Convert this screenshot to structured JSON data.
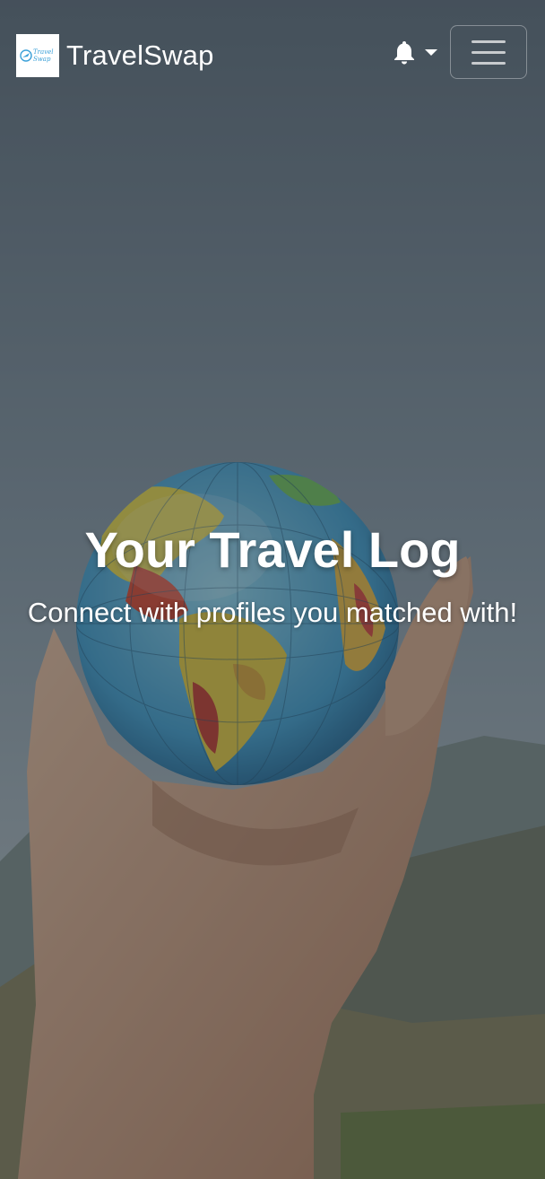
{
  "navbar": {
    "brand_name": "TravelSwap",
    "logo_text_line1": "Travel",
    "logo_text_line2": "Swap",
    "notification_icon": "bell-icon",
    "dropdown_icon": "caret-down-icon",
    "menu_icon": "hamburger-menu-icon"
  },
  "hero": {
    "title": "Your Travel Log",
    "subtitle": "Connect with profiles you matched with!"
  },
  "colors": {
    "logo_accent": "#3aa0d8",
    "text": "#ffffff"
  }
}
